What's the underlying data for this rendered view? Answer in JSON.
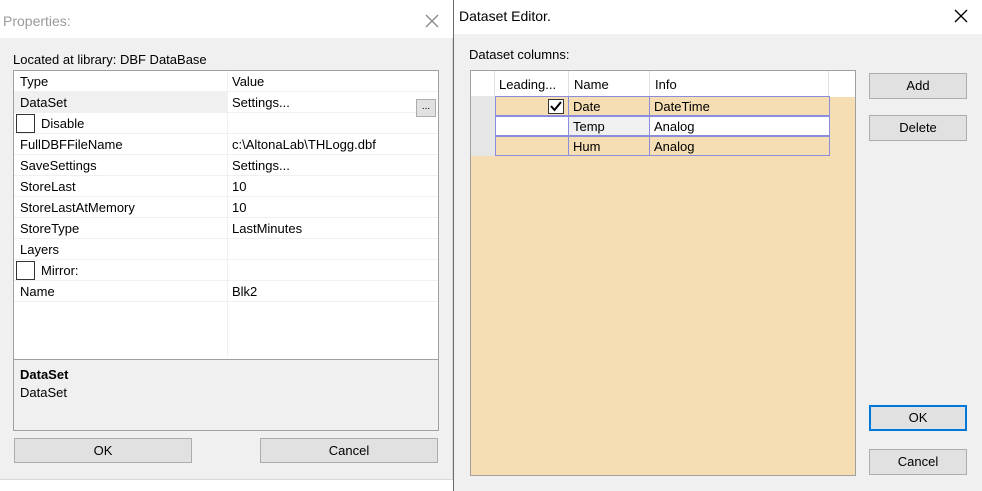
{
  "properties": {
    "title": "Properties:",
    "location": "Located at library: DBF DataBase",
    "header": {
      "type": "Type",
      "value": "Value"
    },
    "rows": [
      {
        "type": "DataSet",
        "value": "Settings..."
      },
      {
        "label": "Disable",
        "checked": false
      },
      {
        "type": "FullDBFFileName",
        "value": "c:\\AltonaLab\\THLogg.dbf"
      },
      {
        "type": "SaveSettings",
        "value": "Settings..."
      },
      {
        "type": "StoreLast",
        "value": "10"
      },
      {
        "type": "StoreLastAtMemory",
        "value": "10"
      },
      {
        "type": "StoreType",
        "value": "LastMinutes"
      },
      {
        "type": "Layers",
        "value": ""
      },
      {
        "label": "Mirror:",
        "checked": false
      },
      {
        "type": "Name",
        "value": "Blk2"
      }
    ],
    "ellipsis": "...",
    "description": {
      "title": "DataSet",
      "text": "DataSet"
    },
    "ok": "OK",
    "cancel": "Cancel"
  },
  "dataset_editor": {
    "title": "Dataset Editor.",
    "columns_label": "Dataset columns:",
    "headers": [
      "Leading...",
      "Name",
      "Info"
    ],
    "rows": [
      {
        "leading": true,
        "name": "Date",
        "info": "DateTime"
      },
      {
        "leading": false,
        "name": "Temp",
        "info": "Analog"
      },
      {
        "leading": false,
        "name": "Hum",
        "info": "Analog"
      }
    ],
    "add": "Add",
    "delete": "Delete",
    "ok": "OK",
    "cancel": "Cancel",
    "grid_background": "#f5deb3",
    "accent": "#0078d7"
  }
}
